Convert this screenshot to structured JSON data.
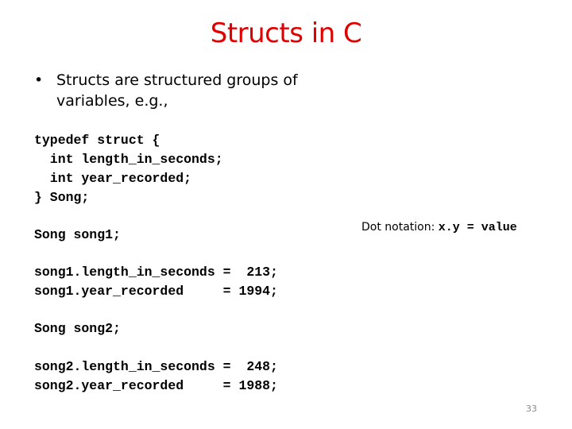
{
  "slide": {
    "title": "Structs in C",
    "bullet_marker": "•",
    "bullet_text": "Structs are structured groups of variables, e.g.,",
    "code_block_typedef": "typedef struct {\n  int length_in_seconds;\n  int year_recorded;\n} Song;",
    "code_block_song1_decl": "Song song1;",
    "code_block_song1_assign": "song1.length_in_seconds =  213;\nsong1.year_recorded     = 1994;",
    "code_block_song2_decl": "Song song2;",
    "code_block_song2_assign": "song2.length_in_seconds =  248;\nsong2.year_recorded     = 1988;",
    "dot_notation_label": "Dot notation: ",
    "dot_notation_code": "x.y = value",
    "page_number": "33"
  },
  "colors": {
    "title": "#e00000",
    "text": "#000000",
    "page_number": "#888888"
  }
}
